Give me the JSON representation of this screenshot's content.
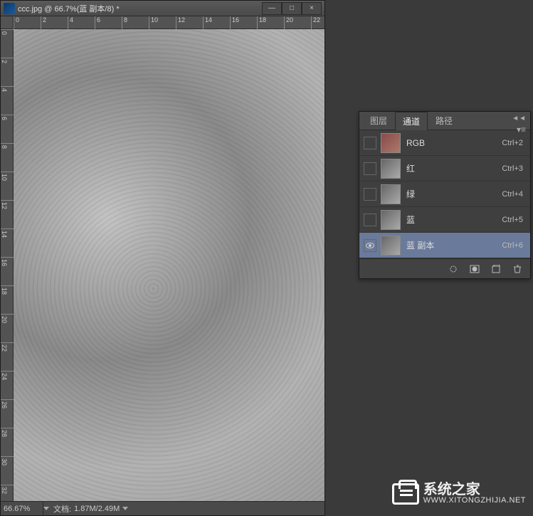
{
  "document": {
    "title": "ccc.jpg @ 66.7%(蓝 副本/8) *",
    "zoom": "66.67%",
    "info_label": "文档:",
    "info_value": "1.87M/2.49M"
  },
  "window_controls": {
    "minimize": "—",
    "maximize": "□",
    "close": "×"
  },
  "ruler_ticks_h": [
    "0",
    "2",
    "4",
    "6",
    "8",
    "10",
    "12",
    "14",
    "16",
    "18",
    "20",
    "22"
  ],
  "ruler_ticks_v": [
    "0",
    "2",
    "4",
    "6",
    "8",
    "10",
    "12",
    "14",
    "16",
    "18",
    "20",
    "22",
    "24",
    "26",
    "28",
    "30",
    "32"
  ],
  "panel": {
    "collapse": "◄◄",
    "menu": "▾≡",
    "tabs": [
      {
        "label": "图层",
        "active": false
      },
      {
        "label": "通道",
        "active": true
      },
      {
        "label": "路径",
        "active": false
      }
    ],
    "channels": [
      {
        "name": "RGB",
        "shortcut": "Ctrl+2",
        "visible": false,
        "selected": false,
        "rgb": true
      },
      {
        "name": "红",
        "shortcut": "Ctrl+3",
        "visible": false,
        "selected": false,
        "rgb": false
      },
      {
        "name": "绿",
        "shortcut": "Ctrl+4",
        "visible": false,
        "selected": false,
        "rgb": false
      },
      {
        "name": "蓝",
        "shortcut": "Ctrl+5",
        "visible": false,
        "selected": false,
        "rgb": false
      },
      {
        "name": "蓝 副本",
        "shortcut": "Ctrl+6",
        "visible": true,
        "selected": true,
        "rgb": false
      }
    ],
    "footer_icons": [
      "load-selection",
      "save-mask",
      "new-channel",
      "delete-channel"
    ]
  },
  "watermark": {
    "cn": "系统之家",
    "url": "WWW.XITONGZHIJIA.NET"
  }
}
